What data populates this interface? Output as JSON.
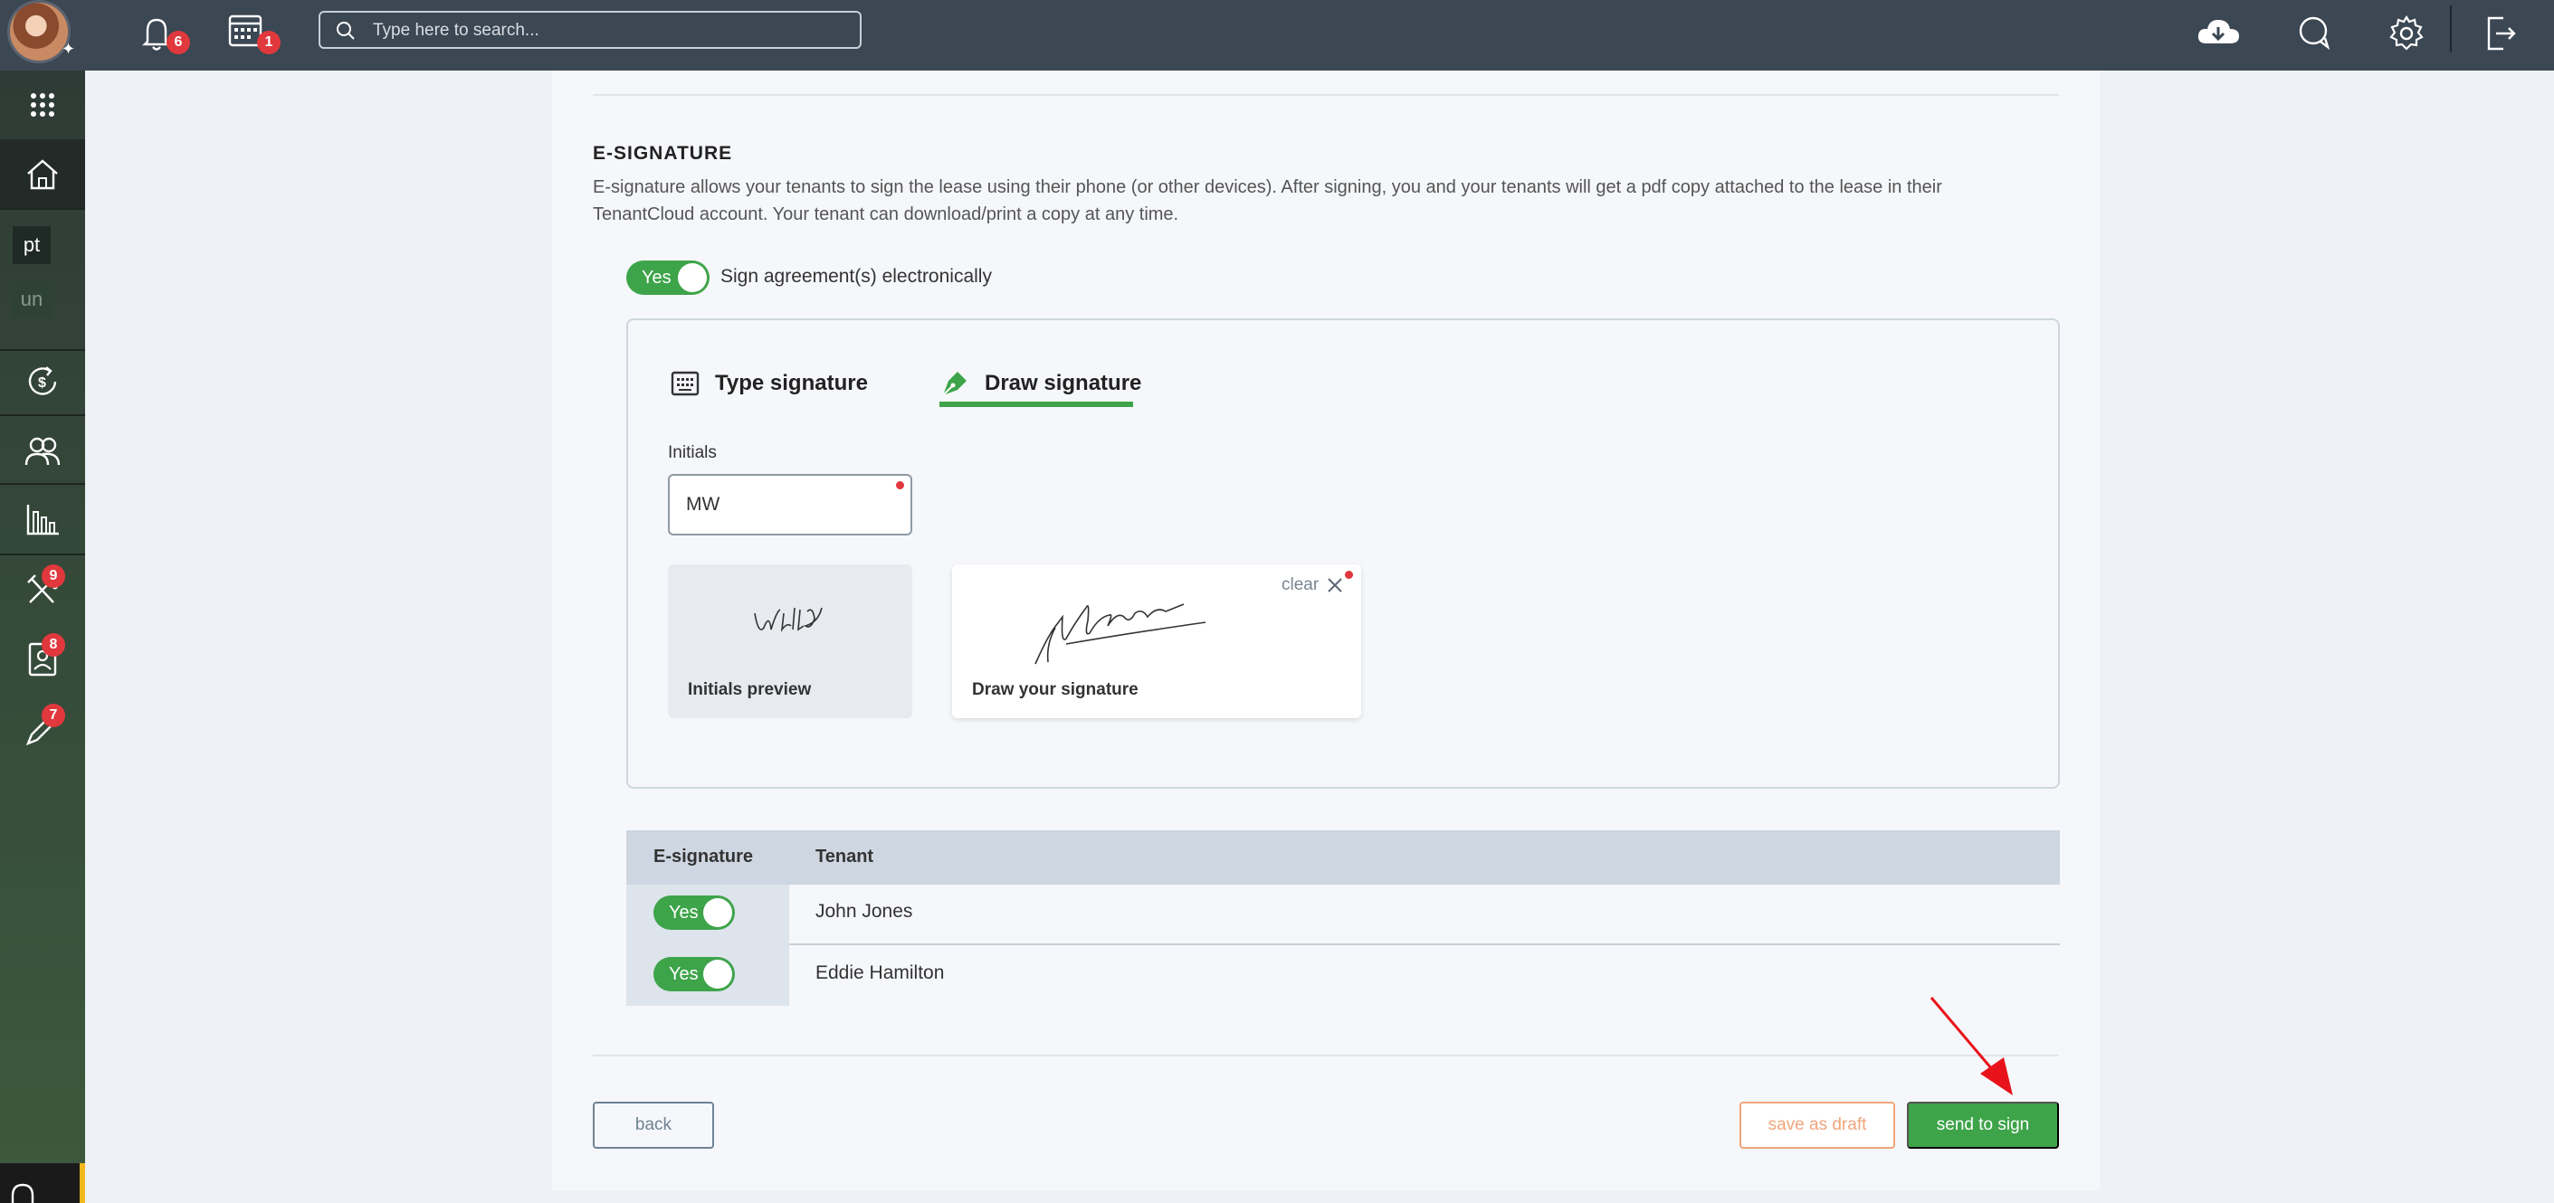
{
  "topbar": {
    "notifications_count": "6",
    "calendar_count": "1",
    "search_placeholder": "Type here to search..."
  },
  "sidebar": {
    "tags": [
      {
        "label": "pt"
      },
      {
        "label": "un"
      }
    ],
    "badges": {
      "maintenance": "9",
      "applications": "8",
      "leases": "7"
    }
  },
  "esignature": {
    "title": "E-SIGNATURE",
    "description": "E-signature allows your tenants to sign the lease using their phone (or other devices). After signing, you and your tenants will get a pdf copy attached to the lease in their TenantCloud account. Your tenant can download/print a copy at any time.",
    "toggle_label": "Yes",
    "sign_label": "Sign agreement(s) electronically"
  },
  "signature_panel": {
    "tabs": [
      {
        "label": "Type signature"
      },
      {
        "label": "Draw signature"
      }
    ],
    "initials_label": "Initials",
    "initials_value": "MW",
    "initials_preview_caption": "Initials preview",
    "draw_caption": "Draw your signature",
    "clear_label": "clear"
  },
  "tenant_table": {
    "headers": [
      "E-signature",
      "Tenant"
    ],
    "rows": [
      {
        "esign": "Yes",
        "tenant": "John Jones"
      },
      {
        "esign": "Yes",
        "tenant": "Eddie Hamilton"
      }
    ]
  },
  "buttons": {
    "back": "back",
    "save_draft": "save as draft",
    "send": "send to sign"
  },
  "colors": {
    "accent_green": "#3ea44a",
    "topbar": "#3b4753",
    "badge_red": "#e0383d",
    "draft_orange": "#f0a57c"
  }
}
